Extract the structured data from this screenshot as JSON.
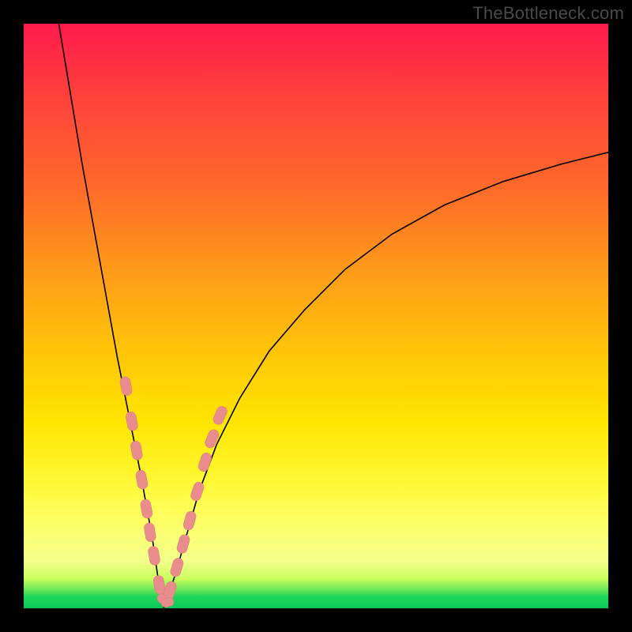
{
  "watermark": "TheBottleneck.com",
  "colors": {
    "background": "#000000",
    "curve": "#000000",
    "bead": "#e88c8c"
  },
  "chart_data": {
    "type": "line",
    "title": "",
    "xlabel": "",
    "ylabel": "",
    "xlim": [
      0,
      100
    ],
    "ylim": [
      0,
      100
    ],
    "grid": false,
    "legend": false,
    "note": "Axes are normalized 0–100; no tick labels are shown in the source image so values are read off relative geometry. Curve y≈0 at minimum near x≈24, rising to y≈100 at left edge and y≈78 at right edge.",
    "series": [
      {
        "name": "left-branch",
        "x": [
          6,
          8,
          10,
          12,
          14,
          16,
          18,
          20,
          22,
          23,
          24
        ],
        "y": [
          100,
          88,
          76,
          65,
          54,
          43,
          33,
          23,
          12,
          5,
          0
        ]
      },
      {
        "name": "right-branch",
        "x": [
          24,
          26,
          28,
          30,
          33,
          37,
          42,
          48,
          55,
          63,
          72,
          82,
          92,
          100
        ],
        "y": [
          0,
          6,
          13,
          20,
          28,
          36,
          44,
          51,
          58,
          64,
          69,
          73,
          76,
          78
        ]
      }
    ],
    "markers": {
      "name": "highlight-beads",
      "shape": "rounded-segment",
      "color": "#e88c8c",
      "points_left": [
        {
          "x": 17.5,
          "y": 38
        },
        {
          "x": 18.5,
          "y": 32
        },
        {
          "x": 19.3,
          "y": 27
        },
        {
          "x": 20.2,
          "y": 22
        },
        {
          "x": 21.0,
          "y": 17
        },
        {
          "x": 21.6,
          "y": 13
        },
        {
          "x": 22.3,
          "y": 9
        },
        {
          "x": 23.2,
          "y": 4
        }
      ],
      "points_right": [
        {
          "x": 25.0,
          "y": 3
        },
        {
          "x": 26.2,
          "y": 7
        },
        {
          "x": 27.3,
          "y": 11
        },
        {
          "x": 28.4,
          "y": 15
        },
        {
          "x": 29.7,
          "y": 20
        },
        {
          "x": 31.0,
          "y": 25
        },
        {
          "x": 32.2,
          "y": 29
        },
        {
          "x": 33.6,
          "y": 33
        }
      ]
    }
  }
}
